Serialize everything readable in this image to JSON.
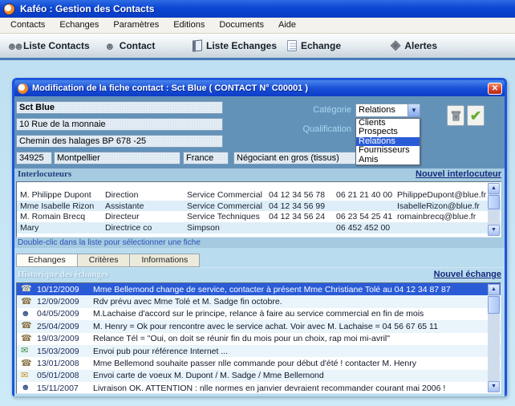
{
  "window": {
    "title": "Kaféo : Gestion des Contacts"
  },
  "menu": {
    "items": [
      {
        "label": "Contacts"
      },
      {
        "label": "Echanges"
      },
      {
        "label": "Paramètres"
      },
      {
        "label": "Editions"
      },
      {
        "label": "Documents"
      },
      {
        "label": "Aide"
      }
    ]
  },
  "toolbar": {
    "items": [
      {
        "label": "Liste Contacts",
        "icon": "people-group-icon"
      },
      {
        "label": "Contact",
        "icon": "person-icon"
      },
      {
        "label": "Liste Echanges",
        "icon": "open-book-icon"
      },
      {
        "label": "Echange",
        "icon": "document-icon"
      },
      {
        "label": "Alertes",
        "icon": "alert-diamond-bell-icon"
      }
    ]
  },
  "dialog": {
    "title": "Modification de la fiche contact : Sct Blue  ( CONTACT  N°  C00001 )",
    "close_glyph": "✕",
    "fields": {
      "name": "Sct Blue",
      "address1": "10 Rue de la monnaie",
      "address2": "Chemin des halages  BP 678 -25",
      "zip": "34925",
      "city": "Montpellier",
      "country": "France",
      "qualification_value": "Négociant en gros (tissus)"
    },
    "category": {
      "label": "Catégorie",
      "value": "Relations",
      "options": [
        {
          "label": "Clients"
        },
        {
          "label": "Prospects"
        },
        {
          "label": "Relations",
          "selected": true
        },
        {
          "label": "Fournisseurs"
        },
        {
          "label": "Amis"
        }
      ]
    },
    "qualification_label": "Qualification",
    "buttons": [
      {
        "name": "delete",
        "icon": "trash-icon"
      },
      {
        "name": "validate",
        "icon": "check-icon"
      }
    ],
    "interlocuteurs": {
      "title": "Interlocuteurs",
      "new_link": "Nouvel interlocuteur",
      "hint": "Double-clic dans la liste pour sélectionner une fiche",
      "rows": [
        {
          "name": "M. Philippe Dupont",
          "role": "Direction",
          "service": "Service Commercial",
          "phone": "04 12 34 56 78",
          "mobile": "06 21 21 40 00",
          "email": "PhilippeDupont@blue.fr"
        },
        {
          "name": "Mme Isabelle Rizon",
          "role": "Assistante",
          "service": "Service Commercial",
          "phone": "04 12 34 56 99",
          "mobile": "",
          "email": "IsabelleRizon@blue.fr"
        },
        {
          "name": "M. Romain Brecq",
          "role": "Directeur",
          "service": "Service Techniques",
          "phone": "04 12 34 56 24",
          "mobile": "06 23 54 25 41",
          "email": "romainbrecq@blue.fr"
        },
        {
          "name": "Mary",
          "role": "Directrice co",
          "service": "Simpson",
          "phone": "",
          "mobile": "06 452 452  00",
          "email": ""
        }
      ]
    },
    "tabs": [
      {
        "label": "Echanges",
        "active": true
      },
      {
        "label": "Critères"
      },
      {
        "label": "Informations"
      }
    ],
    "history": {
      "title": "Historique des échanges",
      "new_link": "Nouvel échange",
      "rows": [
        {
          "icon": "tel",
          "date": "10/12/2009",
          "text": "Mme Bellemond change de service, contacter à présent  Mme Christiane Tolé au 04 12 34 87 87",
          "selected": true
        },
        {
          "icon": "tel",
          "date": "12/09/2009",
          "text": "Rdv prévu avec Mme Tolé et M. Sadge fin octobre."
        },
        {
          "icon": "contact",
          "date": "04/05/2009",
          "text": "M.Lachaise d'accord sur le principe, relance à faire au service commercial en fin de mois"
        },
        {
          "icon": "tel",
          "date": "25/04/2009",
          "text": "M. Henry = Ok pour rencontre avec le service achat. Voir avec M. Lachaise = 04 56 67 65 11"
        },
        {
          "icon": "tel",
          "date": "19/03/2009",
          "text": "Relance Tél = \"Oui, on doit se réunir fin du mois pour un choix, rap moi mi-avril\""
        },
        {
          "icon": "envoi",
          "date": "15/03/2009",
          "text": "Envoi pub pour référence Internet ..."
        },
        {
          "icon": "tel",
          "date": "13/01/2008",
          "text": "Mme Bellemond souhaite passer nlle commande pour début d'été ! contacter M. Henry"
        },
        {
          "icon": "courrier",
          "date": "05/01/2008",
          "text": "Envoi carte de voeux M. Dupont / M. Sadge / Mme Bellemond"
        },
        {
          "icon": "contact",
          "date": "15/11/2007",
          "text": "Livraison OK. ATTENTION : nlle normes en janvier devraient recommander courant mai 2006 !"
        }
      ]
    }
  },
  "colors": {
    "titlebar_blue": "#0b46d4",
    "dialog_steel_blue": "#6392b9",
    "panel_light_blue": "#b9dcee",
    "selection_blue": "#2a5bd7",
    "link_navy": "#14297c",
    "close_red": "#da4530",
    "check_green": "#64ad2e"
  }
}
